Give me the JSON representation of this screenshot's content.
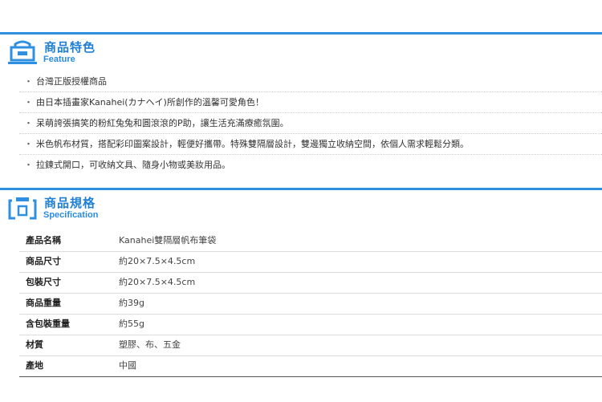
{
  "feature": {
    "title": "商品特色",
    "subtitle": "Feature",
    "items": [
      "台灣正版授權商品",
      "由日本插畫家Kanahei(カナヘイ)所創作的溫馨可愛角色！",
      "呆萌誇張搞笑的粉紅兔兔和圓滾滾的P助，讓生活充滿療癒氛圍。",
      "米色帆布材質，搭配彩印圖案設計，輕便好攜帶。特殊雙隔層設計，雙邊獨立收納空間，依個人需求輕鬆分類。",
      "拉鍊式開口，可收納文具、隨身小物或美妝用品。"
    ],
    "bullet": "・"
  },
  "spec": {
    "title": "商品規格",
    "subtitle": "Specification",
    "rows": [
      {
        "key": "產品名稱",
        "value": "Kanahei雙隔層帆布筆袋"
      },
      {
        "key": "商品尺寸",
        "value": "約20×7.5×4.5cm"
      },
      {
        "key": "包裝尺寸",
        "value": "約20×7.5×4.5cm"
      },
      {
        "key": "商品重量",
        "value": "約39g"
      },
      {
        "key": "含包裝重量",
        "value": "約55g"
      },
      {
        "key": "材質",
        "value": "塑膠、布、五金"
      },
      {
        "key": "產地",
        "value": "中國"
      }
    ]
  },
  "colors": {
    "accent": "#2f8fe0",
    "title_text": "#1f7fd6"
  }
}
